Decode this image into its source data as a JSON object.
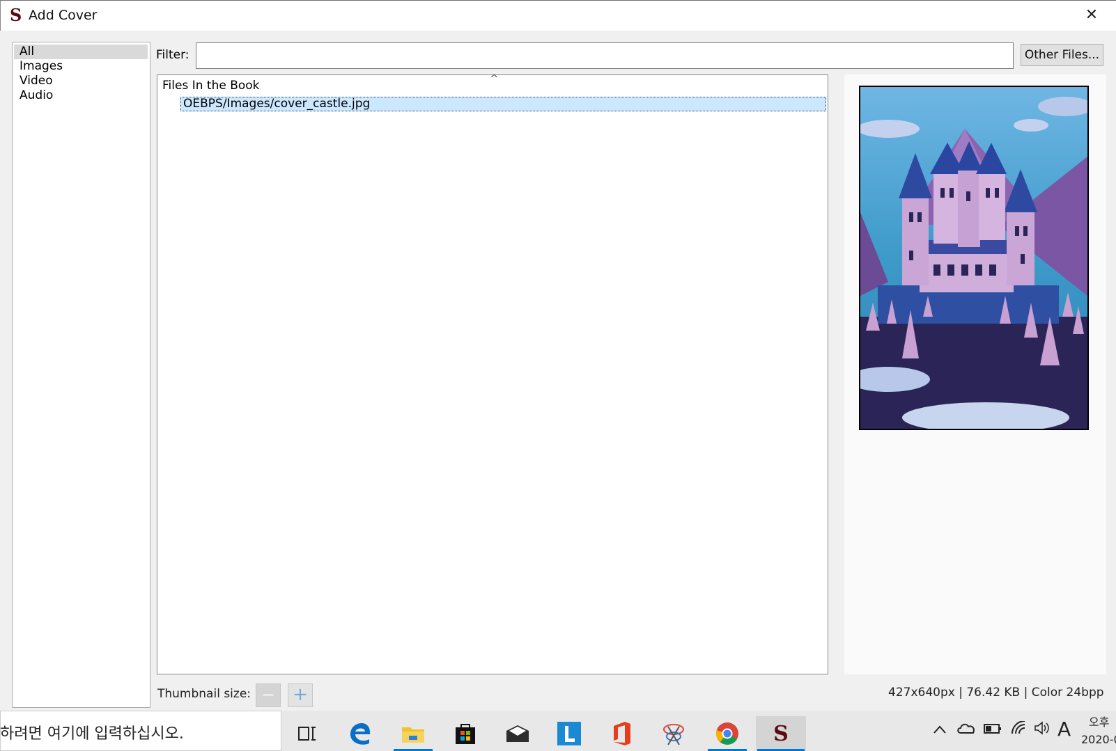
{
  "window": {
    "title": "Add Cover",
    "logo": "S",
    "close": "✕"
  },
  "types": [
    "All",
    "Images",
    "Video",
    "Audio"
  ],
  "filter": {
    "label": "Filter:",
    "value": "",
    "other_files_label": "Other Files..."
  },
  "files": {
    "sort_indicator": "^",
    "header": "Files In the Book",
    "items": [
      "OEBPS/Images/cover_castle.jpg"
    ]
  },
  "thumbnail": {
    "label": "Thumbnail size:",
    "minus": "−",
    "plus": "+"
  },
  "image_info": "427x640px | 76.42 KB | Color 24bpp",
  "taskbar": {
    "search_text": "하려면 여기에 입력하십시오.",
    "apps": [
      "task-view",
      "edge",
      "file-explorer",
      "store",
      "mail",
      "l-app",
      "office",
      "snip",
      "chrome",
      "sigil"
    ],
    "tray_input_indicator": "A",
    "clock_top": "오후",
    "clock_bottom": "2020-0"
  },
  "colors": {
    "selection": "#cce8ff",
    "accent": "#0078d7",
    "brand": "#5a0a14"
  }
}
